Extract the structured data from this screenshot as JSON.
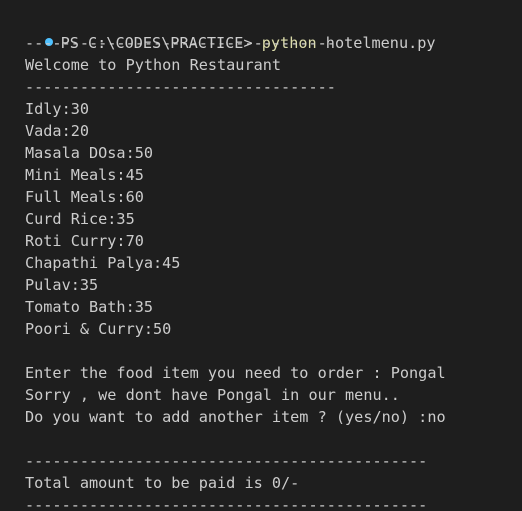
{
  "terminal": {
    "status_color": "#4fc1ff",
    "command_color": "#dcdcaa",
    "prompt": "PS C:\\CODES\\PRACTICE>",
    "command": "python",
    "command_arg": "hotelmenu.py",
    "separator_short": "----------------------------------",
    "welcome": "Welcome to Python Restaurant",
    "menu": [
      "Idly:30",
      "Vada:20",
      "Masala DOsa:50",
      "Mini Meals:45",
      "Full Meals:60",
      "Curd Rice:35",
      "Roti Curry:70",
      "Chapathi Palya:45",
      "Pulav:35",
      "Tomato Bath:35",
      "Poori & Curry:50"
    ],
    "order_prompt": "Enter the food item you need to order : Pongal",
    "sorry_msg": "Sorry , we dont have Pongal in our menu..",
    "another_prompt": "Do you want to add another item ? (yes/no) :no",
    "separator_long": "--------------------------------------------",
    "total": "Total amount to be paid is 0/-",
    "separator_bottom": "--------------------------------------------"
  }
}
